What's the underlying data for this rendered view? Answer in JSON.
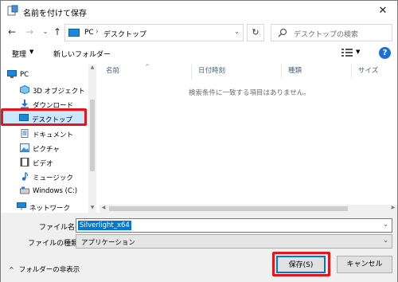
{
  "window": {
    "title": "名前を付けて保存",
    "close_glyph": "✕"
  },
  "address": {
    "path": [
      "PC",
      "デスクトップ"
    ],
    "separator": "›",
    "search_placeholder": "デスクトップの検索"
  },
  "toolbar": {
    "organize_label": "整理",
    "new_folder_label": "新しいフォルダー",
    "help_label": "?"
  },
  "nav": {
    "items": [
      {
        "label": "PC",
        "icon": "pc-icon"
      },
      {
        "label": "3D オブジェクト",
        "icon": "3d-objects-icon"
      },
      {
        "label": "ダウンロード",
        "icon": "download-icon"
      },
      {
        "label": "デスクトップ",
        "icon": "desktop-icon",
        "selected": true
      },
      {
        "label": "ドキュメント",
        "icon": "documents-icon"
      },
      {
        "label": "ピクチャ",
        "icon": "pictures-icon"
      },
      {
        "label": "ビデオ",
        "icon": "videos-icon"
      },
      {
        "label": "ミュージック",
        "icon": "music-icon"
      },
      {
        "label": "Windows (C:)",
        "icon": "drive-icon"
      }
    ],
    "network_label": "ネットワーク"
  },
  "list": {
    "columns": [
      "名前",
      "日付時刻",
      "種類",
      "サイズ"
    ],
    "empty_message": "検索条件に一致する項目はありません。"
  },
  "form": {
    "filename_label": "ファイル名(N):",
    "filename_value": "Silverlight_x64",
    "filetype_label": "ファイルの種類(T):",
    "filetype_value": "アプリケーション"
  },
  "footer": {
    "hide_folders_label": "フォルダーの非表示",
    "save_label": "保存(S)",
    "cancel_label": "キャンセル"
  },
  "colors": {
    "highlight": "#e8141b",
    "selection": "#cce8ff",
    "accent": "#0078d7"
  }
}
